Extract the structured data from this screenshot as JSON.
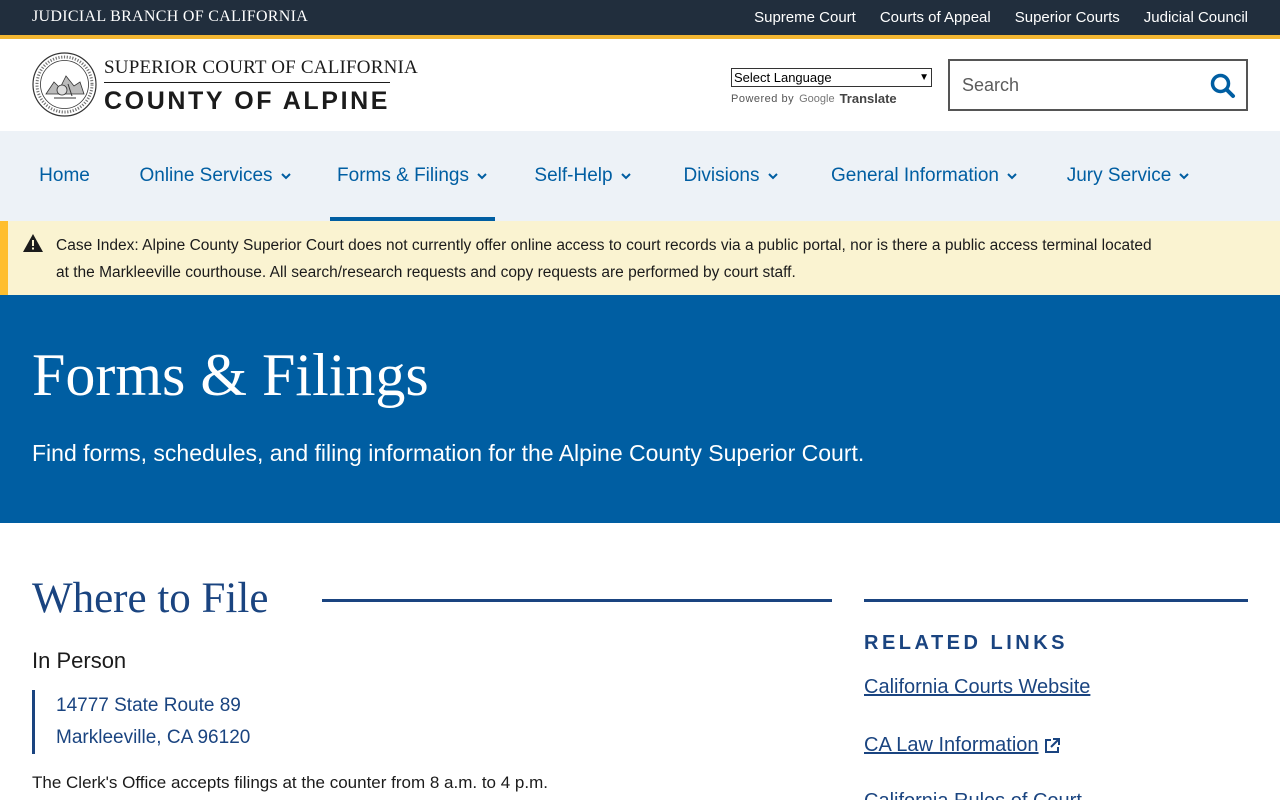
{
  "utility": {
    "branch_name": "JUDICIAL BRANCH OF CALIFORNIA",
    "links": [
      "Supreme Court",
      "Courts of Appeal",
      "Superior Courts",
      "Judicial Council"
    ]
  },
  "header": {
    "court_line1": "SUPERIOR COURT OF CALIFORNIA",
    "court_line2": "COUNTY OF ALPINE",
    "language_select": "Select Language",
    "powered_by": "Powered by",
    "google": "Google",
    "translate": "Translate",
    "search_placeholder": "Search"
  },
  "nav": {
    "items": [
      {
        "label": "Home"
      },
      {
        "label": "Online Services"
      },
      {
        "label": "Forms & Filings"
      },
      {
        "label": "Self-Help"
      },
      {
        "label": "Divisions"
      },
      {
        "label": "General Information"
      },
      {
        "label": "Jury Service"
      }
    ],
    "active": "Forms & Filings"
  },
  "alert": {
    "label": "Case Index:",
    "text": "Alpine County Superior Court does not currently offer online access to court records via a public portal, nor is there a public access terminal located at the Markleeville courthouse. All search/research requests and copy requests are performed by court staff."
  },
  "hero": {
    "title": "Forms & Filings",
    "subtitle": "Find forms, schedules, and filing information for the Alpine County Superior Court."
  },
  "main": {
    "section_title": "Where to File",
    "in_person_heading": "In Person",
    "address_line1": "14777 State Route 89",
    "address_line2": "Markleeville, CA 96120",
    "clerk_note": "The Clerk's Office accepts filings at the counter from 8 a.m. to 4 p.m."
  },
  "sidebar": {
    "title": "RELATED LINKS",
    "links": [
      {
        "label": "California Courts Website"
      },
      {
        "label": "CA Law Information"
      },
      {
        "label": "California Rules of Court"
      }
    ]
  },
  "colors": {
    "utility_bg": "#212e3d",
    "gold": "#f2b632",
    "nav_bg": "#edf2f7",
    "link_blue": "#005ea2",
    "heading_navy": "#1a4480",
    "alert_bg": "#faf3d1",
    "hero_bg": "#005ea2"
  }
}
